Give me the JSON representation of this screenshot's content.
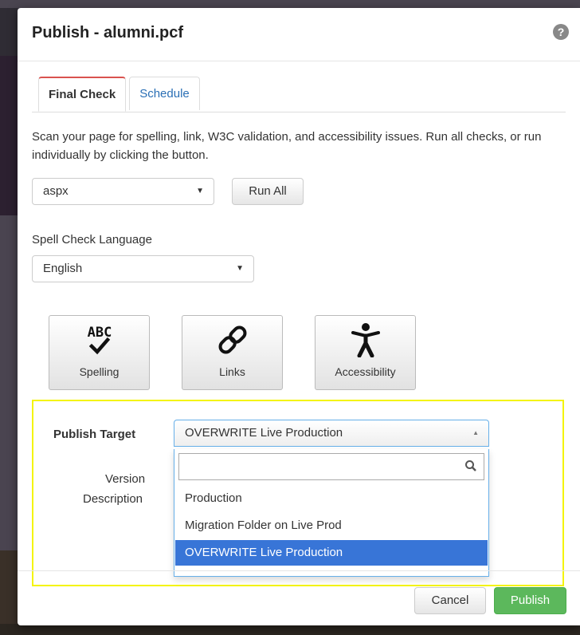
{
  "dialog": {
    "title": "Publish - alumni.pcf",
    "help_icon": "question-circle-icon"
  },
  "tabs": [
    {
      "label": "Final Check",
      "active": true
    },
    {
      "label": "Schedule",
      "active": false
    }
  ],
  "final_check": {
    "description": "Scan your page for spelling, link, W3C validation, and accessibility issues. Run all checks, or run individually by clicking the button.",
    "doctype_select": "aspx",
    "run_all_label": "Run All",
    "spell_lang_label": "Spell Check Language",
    "spell_lang_select": "English",
    "checks": [
      {
        "label": "Spelling",
        "icon": "spellcheck-abc-icon"
      },
      {
        "label": "Links",
        "icon": "link-icon"
      },
      {
        "label": "Accessibility",
        "icon": "accessibility-icon"
      }
    ]
  },
  "publish": {
    "target_label": "Publish Target",
    "target_value": "OVERWRITE Live Production",
    "version_label_line1": "Version",
    "version_label_line2": "Description",
    "search_placeholder": "",
    "options": [
      {
        "label": "Production",
        "selected": false
      },
      {
        "label": "Migration Folder on Live Prod",
        "selected": false
      },
      {
        "label": "OVERWRITE Live Production",
        "selected": true
      }
    ]
  },
  "footer": {
    "cancel_label": "Cancel",
    "publish_label": "Publish"
  },
  "colors": {
    "tab_accent": "#d9534f",
    "highlight": "#f4f40a",
    "selected_option": "#3875d7",
    "publish_button": "#5cb85c"
  }
}
